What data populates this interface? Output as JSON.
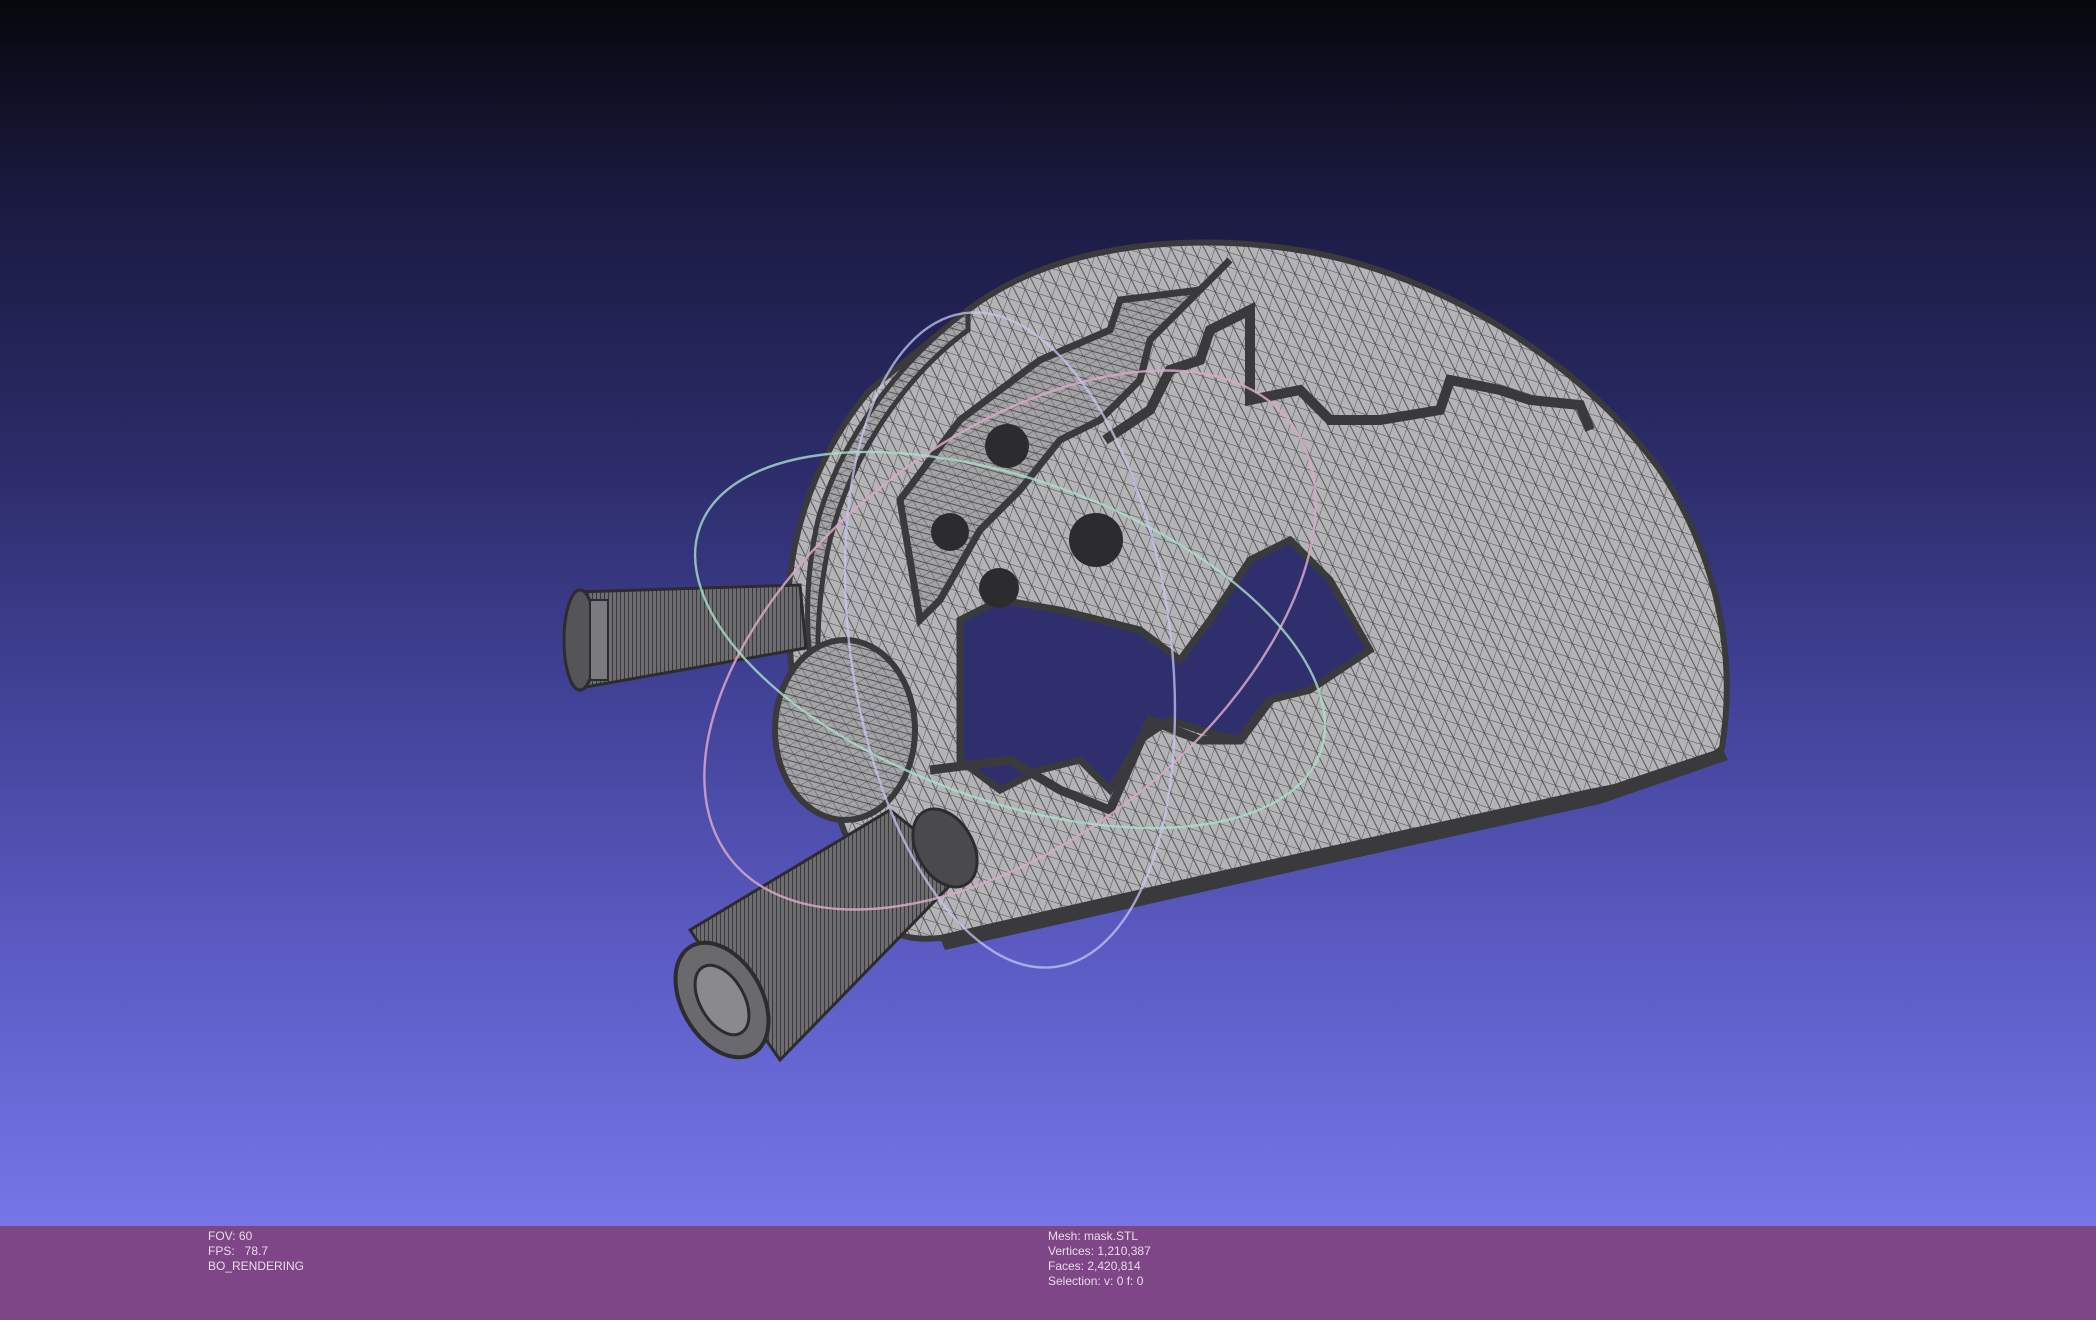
{
  "info_left": {
    "fov": "FOV: 60",
    "fps": "FPS:   78.7",
    "render_mode": "BO_RENDERING"
  },
  "info_right": {
    "mesh": "Mesh: mask.STL",
    "vertices": "Vertices: 1,210,387",
    "faces": "Faces: 2,420,814",
    "selection": "Selection: v: 0 f: 0"
  },
  "colors": {
    "infobar_bg": "#7e4686",
    "viewport_top": "#07070d",
    "viewport_bottom": "#7676e8",
    "mesh_fill": "#a9a9ac",
    "mesh_wire": "#3a3a3c"
  },
  "icons": [
    "trackball-gizmo-icon"
  ]
}
